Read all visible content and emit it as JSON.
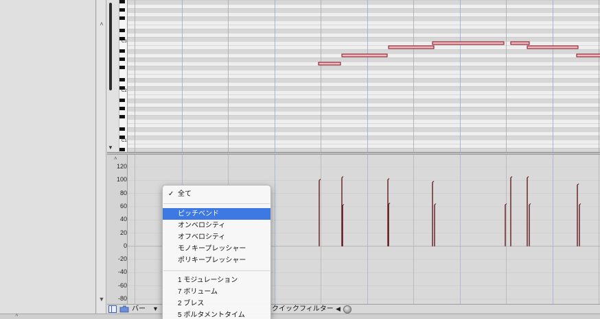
{
  "piano_roll": {
    "octave_labels": [
      "C3",
      "C2",
      "C1"
    ],
    "notes": [
      {
        "pitch": "G2"
      },
      {
        "pitch": "A2"
      },
      {
        "pitch": "B2"
      },
      {
        "pitch": "C3"
      },
      {
        "pitch": "C3"
      },
      {
        "pitch": "B2"
      },
      {
        "pitch": "A2"
      }
    ]
  },
  "controller_lane": {
    "axis_labels": [
      "120",
      "100",
      "80",
      "60",
      "40",
      "20",
      "0",
      "-20",
      "-40",
      "-60",
      "-80"
    ],
    "axis_range": [
      -80,
      120
    ]
  },
  "toolbar": {
    "view_label": "バー",
    "quick_filter_label": "クイックフィルター"
  },
  "menu": {
    "checked_item": "全て",
    "group1": [
      "ピッチベンド",
      "オンベロシティ",
      "オフベロシティ",
      "モノキープレッシャー",
      "ポリキープレッシャー"
    ],
    "group2": [
      "1 モジュレーション",
      "7 ボリューム",
      "2 ブレス",
      "5 ポルタメントタイム"
    ]
  },
  "colors": {
    "menu_highlight": "#3d78e3",
    "note_fill": "#f2b8be",
    "note_border": "#7a0d18",
    "event_line": "#5a0a12"
  }
}
